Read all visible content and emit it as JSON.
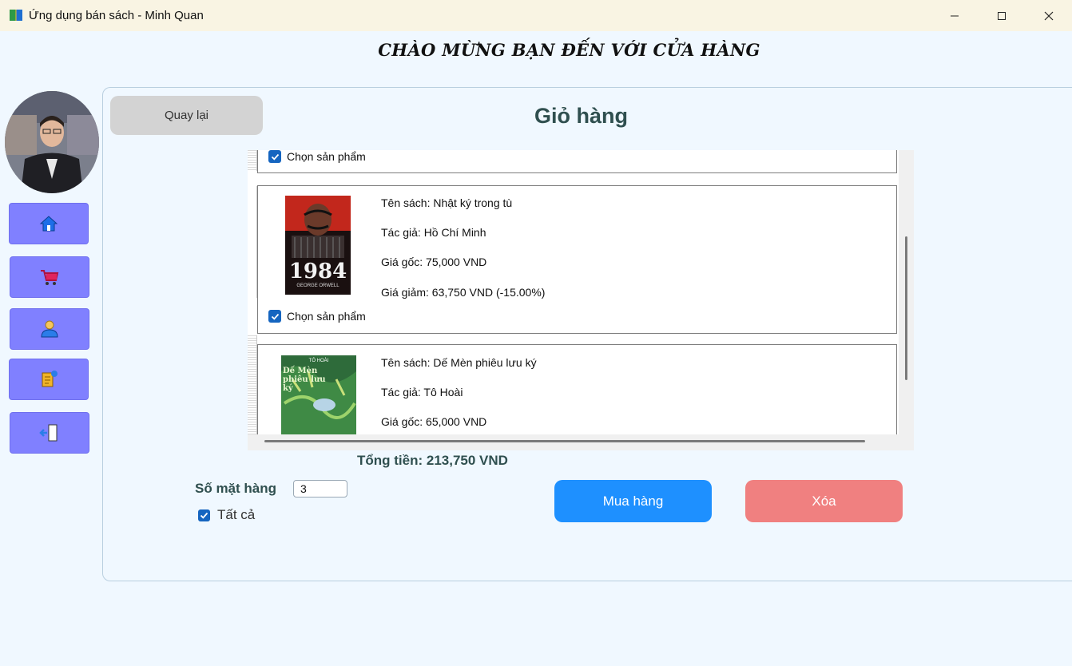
{
  "window": {
    "title": "Ứng dụng bán sách - Minh Quan",
    "minimize_glyph": "—",
    "maximize_glyph": "☐",
    "close_glyph": "✕"
  },
  "header": {
    "welcome": "CHÀO MỪNG BẠN ĐẾN VỚI CỬA HÀNG"
  },
  "sidebar": {
    "items": [
      {
        "icon": "home-icon",
        "color": "#1e6ee8"
      },
      {
        "icon": "shopping-cart-icon",
        "color": "#e0245e"
      },
      {
        "icon": "user-icon",
        "color": "#2b7de9"
      },
      {
        "icon": "order-history-icon",
        "color": "#f0b429"
      },
      {
        "icon": "logout-icon",
        "color": "#2b7de9"
      }
    ]
  },
  "main": {
    "back_label": "Quay lại",
    "title": "Giỏ hàng"
  },
  "cart": {
    "select_label": "Chọn sản phẩm",
    "items": [
      {
        "name": "Tên sách: Nhật ký trong tù",
        "author": "Tác giả: Hồ Chí Minh",
        "original_price": "Giá gốc: 75,000 VND",
        "discount_price": "Giá giảm: 63,750 VND (-15.00%)",
        "cover_title": "1984",
        "cover_author": "GEORGE ORWELL",
        "checked": true
      },
      {
        "name": "Tên sách: Dế Mèn phiêu lưu ký",
        "author": "Tác giả: Tô Hoài",
        "original_price": "Giá gốc: 65,000 VND",
        "cover_title": "Dế Mèn phiêu lưu ký",
        "cover_author": "TÔ HOÀI"
      }
    ]
  },
  "summary": {
    "total": "Tổng tiền: 213,750 VND",
    "qty_label": "Số mặt hàng",
    "qty_value": "3",
    "select_all_label": "Tất cả",
    "select_all_checked": true
  },
  "actions": {
    "buy_label": "Mua hàng",
    "delete_label": "Xóa"
  },
  "colors": {
    "background": "#f0f8ff",
    "nav_button": "#8080ff",
    "buy_button": "#1e90ff",
    "delete_button": "#f08080",
    "back_button": "#d3d3d3",
    "heading": "#2f4f4f",
    "checkbox": "#1565c0"
  }
}
